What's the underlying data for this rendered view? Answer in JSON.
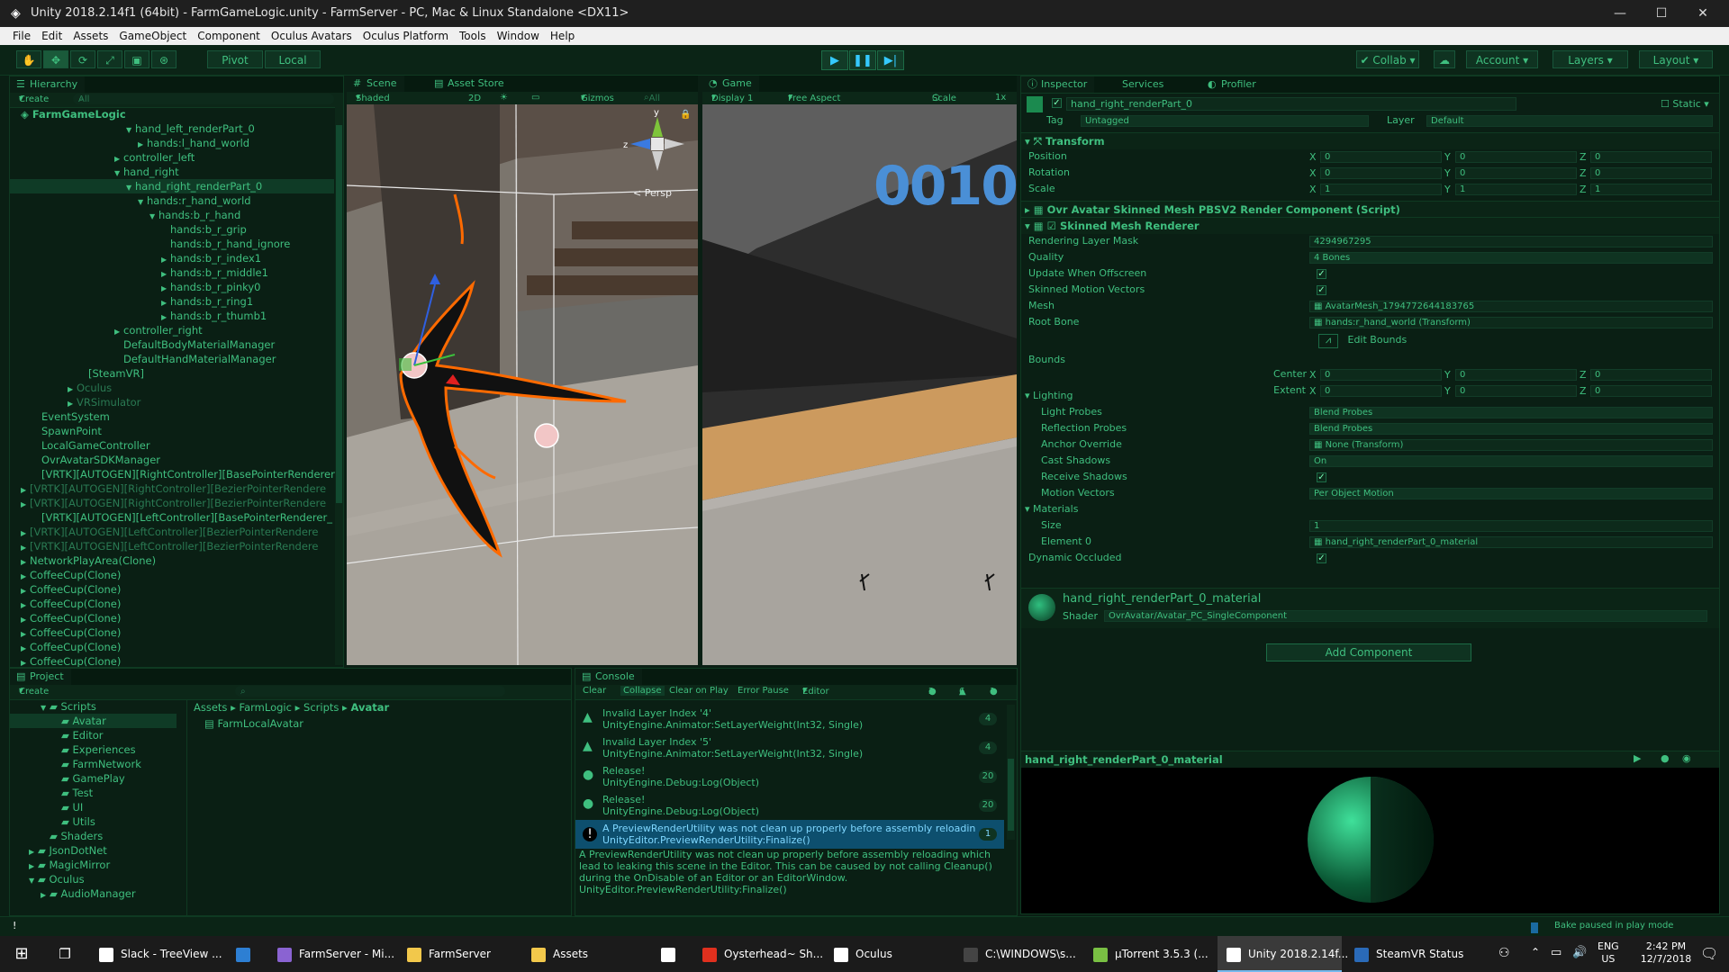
{
  "window": {
    "title": "Unity 2018.2.14f1 (64bit) - FarmGameLogic.unity - FarmServer - PC, Mac & Linux Standalone <DX11>"
  },
  "menu": [
    "File",
    "Edit",
    "Assets",
    "GameObject",
    "Component",
    "Oculus Avatars",
    "Oculus Platform",
    "Tools",
    "Window",
    "Help"
  ],
  "toolbar": {
    "pivot": "Pivot",
    "local": "Local",
    "collab": "Collab",
    "account": "Account",
    "layers": "Layers",
    "layout": "Layout"
  },
  "hierarchy": {
    "tab": "Hierarchy",
    "create": "Create",
    "search": "All",
    "scene": "FarmGameLogic",
    "items": [
      {
        "label": "hand_left_renderPart_0",
        "indent": 9,
        "arrow": "open"
      },
      {
        "label": "hands:l_hand_world",
        "indent": 10,
        "arrow": "closed"
      },
      {
        "label": "controller_left",
        "indent": 8,
        "arrow": "closed"
      },
      {
        "label": "hand_right",
        "indent": 8,
        "arrow": "open"
      },
      {
        "label": "hand_right_renderPart_0",
        "indent": 9,
        "arrow": "open",
        "sel": true
      },
      {
        "label": "hands:r_hand_world",
        "indent": 10,
        "arrow": "open"
      },
      {
        "label": "hands:b_r_hand",
        "indent": 11,
        "arrow": "open"
      },
      {
        "label": "hands:b_r_grip",
        "indent": 12,
        "arrow": ""
      },
      {
        "label": "hands:b_r_hand_ignore",
        "indent": 12,
        "arrow": ""
      },
      {
        "label": "hands:b_r_index1",
        "indent": 12,
        "arrow": "closed"
      },
      {
        "label": "hands:b_r_middle1",
        "indent": 12,
        "arrow": "closed"
      },
      {
        "label": "hands:b_r_pinky0",
        "indent": 12,
        "arrow": "closed"
      },
      {
        "label": "hands:b_r_ring1",
        "indent": 12,
        "arrow": "closed"
      },
      {
        "label": "hands:b_r_thumb1",
        "indent": 12,
        "arrow": "closed"
      },
      {
        "label": "controller_right",
        "indent": 8,
        "arrow": "closed"
      },
      {
        "label": "DefaultBodyMaterialManager",
        "indent": 8,
        "arrow": ""
      },
      {
        "label": "DefaultHandMaterialManager",
        "indent": 8,
        "arrow": ""
      },
      {
        "label": "[SteamVR]",
        "indent": 5,
        "arrow": ""
      },
      {
        "label": "Oculus",
        "indent": 4,
        "arrow": "closed",
        "dim": true
      },
      {
        "label": "VRSimulator",
        "indent": 4,
        "arrow": "closed",
        "dim": true
      },
      {
        "label": "EventSystem",
        "indent": 1,
        "arrow": ""
      },
      {
        "label": "SpawnPoint",
        "indent": 1,
        "arrow": ""
      },
      {
        "label": "LocalGameController",
        "indent": 1,
        "arrow": ""
      },
      {
        "label": "OvrAvatarSDKManager",
        "indent": 1,
        "arrow": ""
      },
      {
        "label": "[VRTK][AUTOGEN][RightController][BasePointerRenderer",
        "indent": 1,
        "arrow": ""
      },
      {
        "label": "[VRTK][AUTOGEN][RightController][BezierPointerRendere",
        "indent": 0,
        "arrow": "closed",
        "dim": true
      },
      {
        "label": "[VRTK][AUTOGEN][RightController][BezierPointerRendere",
        "indent": 0,
        "arrow": "closed",
        "dim": true
      },
      {
        "label": "[VRTK][AUTOGEN][LeftController][BasePointerRenderer_",
        "indent": 1,
        "arrow": ""
      },
      {
        "label": "[VRTK][AUTOGEN][LeftController][BezierPointerRendere",
        "indent": 0,
        "arrow": "closed",
        "dim": true
      },
      {
        "label": "[VRTK][AUTOGEN][LeftController][BezierPointerRendere",
        "indent": 0,
        "arrow": "closed",
        "dim": true
      },
      {
        "label": "NetworkPlayArea(Clone)",
        "indent": 0,
        "arrow": "closed"
      },
      {
        "label": "CoffeeCup(Clone)",
        "indent": 0,
        "arrow": "closed"
      },
      {
        "label": "CoffeeCup(Clone)",
        "indent": 0,
        "arrow": "closed"
      },
      {
        "label": "CoffeeCup(Clone)",
        "indent": 0,
        "arrow": "closed"
      },
      {
        "label": "CoffeeCup(Clone)",
        "indent": 0,
        "arrow": "closed"
      },
      {
        "label": "CoffeeCup(Clone)",
        "indent": 0,
        "arrow": "closed"
      },
      {
        "label": "CoffeeCup(Clone)",
        "indent": 0,
        "arrow": "closed"
      },
      {
        "label": "CoffeeCup(Clone)",
        "indent": 0,
        "arrow": "closed"
      }
    ]
  },
  "scene": {
    "tab": "Scene",
    "assetstore": "Asset Store",
    "shaded": "Shaded",
    "twod": "2D",
    "gizmos": "Gizmos",
    "all": "All",
    "persp": "Persp",
    "axis_y": "y",
    "axis_z": "z"
  },
  "game": {
    "tab": "Game",
    "display": "Display 1",
    "aspect": "Free Aspect",
    "scale": "Scale",
    "scale_val": "1x",
    "sign": "0010"
  },
  "inspector": {
    "tab": "Inspector",
    "services": "Services",
    "profiler": "Profiler",
    "object_name": "hand_right_renderPart_0",
    "static": "Static",
    "tag_label": "Tag",
    "tag": "Untagged",
    "layer_label": "Layer",
    "layer": "Default",
    "transform": {
      "title": "Transform",
      "rows": [
        {
          "label": "Position",
          "x": "0",
          "y": "0",
          "z": "0"
        },
        {
          "label": "Rotation",
          "x": "0",
          "y": "0",
          "z": "0"
        },
        {
          "label": "Scale",
          "x": "1",
          "y": "1",
          "z": "1"
        }
      ]
    },
    "ovr_component": "Ovr Avatar Skinned Mesh PBSV2 Render Component (Script)",
    "smr": {
      "title": "Skinned Mesh Renderer",
      "rendering_layer_mask_label": "Rendering Layer Mask",
      "rendering_layer_mask": "4294967295",
      "quality_label": "Quality",
      "quality": "4 Bones",
      "update_offscreen_label": "Update When Offscreen",
      "skinned_motion_label": "Skinned Motion Vectors",
      "mesh_label": "Mesh",
      "mesh": "AvatarMesh_1794772644183765",
      "root_bone_label": "Root Bone",
      "root_bone": "hands:r_hand_world (Transform)",
      "edit_bounds": "Edit Bounds",
      "bounds_label": "Bounds",
      "center_label": "Center",
      "extent_label": "Extent",
      "center": {
        "x": "0",
        "y": "0",
        "z": "0"
      },
      "extent": {
        "x": "0",
        "y": "0",
        "z": "0"
      },
      "lighting_label": "Lighting",
      "light_probes_label": "Light Probes",
      "light_probes": "Blend Probes",
      "reflection_probes_label": "Reflection Probes",
      "reflection_probes": "Blend Probes",
      "anchor_override_label": "Anchor Override",
      "anchor_override": "None (Transform)",
      "cast_shadows_label": "Cast Shadows",
      "cast_shadows": "On",
      "receive_shadows_label": "Receive Shadows",
      "motion_vectors_label": "Motion Vectors",
      "motion_vectors": "Per Object Motion",
      "materials_label": "Materials",
      "size_label": "Size",
      "size": "1",
      "element0_label": "Element 0",
      "element0": "hand_right_renderPart_0_material",
      "dynamic_occluded_label": "Dynamic Occluded"
    },
    "material": {
      "name": "hand_right_renderPart_0_material",
      "shader_label": "Shader",
      "shader": "OvrAvatar/Avatar_PC_SingleComponent"
    },
    "add_component": "Add Component",
    "preview_title": "hand_right_renderPart_0_material"
  },
  "project": {
    "tab": "Project",
    "create": "Create",
    "breadcrumb": [
      "Assets",
      "FarmLogic",
      "Scripts",
      "Avatar"
    ],
    "asset": "FarmLocalAvatar",
    "tree": [
      {
        "label": "Scripts",
        "indent": 2,
        "arrow": "open"
      },
      {
        "label": "Avatar",
        "indent": 3,
        "arrow": "",
        "sel": true
      },
      {
        "label": "Editor",
        "indent": 3,
        "arrow": ""
      },
      {
        "label": "Experiences",
        "indent": 3,
        "arrow": ""
      },
      {
        "label": "FarmNetwork",
        "indent": 3,
        "arrow": ""
      },
      {
        "label": "GamePlay",
        "indent": 3,
        "arrow": ""
      },
      {
        "label": "Test",
        "indent": 3,
        "arrow": ""
      },
      {
        "label": "UI",
        "indent": 3,
        "arrow": ""
      },
      {
        "label": "Utils",
        "indent": 3,
        "arrow": ""
      },
      {
        "label": "Shaders",
        "indent": 2,
        "arrow": ""
      },
      {
        "label": "JsonDotNet",
        "indent": 1,
        "arrow": "closed"
      },
      {
        "label": "MagicMirror",
        "indent": 1,
        "arrow": "closed"
      },
      {
        "label": "Oculus",
        "indent": 1,
        "arrow": "open"
      },
      {
        "label": "AudioManager",
        "indent": 2,
        "arrow": "closed"
      }
    ]
  },
  "console": {
    "tab": "Console",
    "clear": "Clear",
    "collapse": "Collapse",
    "clear_on_play": "Clear on Play",
    "error_pause": "Error Pause",
    "editor": "Editor",
    "count_info": "2",
    "count_warn": "6",
    "count_err": "1",
    "logs": [
      {
        "type": "warn",
        "l1": "Invalid Layer Index '4'",
        "l2": "UnityEngine.Animator:SetLayerWeight(Int32, Single)",
        "count": "4"
      },
      {
        "type": "warn",
        "l1": "Invalid Layer Index '5'",
        "l2": "UnityEngine.Animator:SetLayerWeight(Int32, Single)",
        "count": "4"
      },
      {
        "type": "info",
        "l1": "Release!",
        "l2": "UnityEngine.Debug:Log(Object)",
        "count": "20"
      },
      {
        "type": "info",
        "l1": "Release!",
        "l2": "UnityEngine.Debug:Log(Object)",
        "count": "20"
      },
      {
        "type": "error",
        "l1": "A PreviewRenderUtility was not clean up properly before assembly reloadin",
        "l2": "UnityEditor.PreviewRenderUtility:Finalize()",
        "count": "1"
      }
    ],
    "detail": [
      "A PreviewRenderUtility was not clean up properly before assembly reloading which",
      "lead to leaking this scene in the Editor. This can be caused by not calling Cleanup()",
      "during the OnDisable of an Editor or an EditorWindow.",
      "UnityEditor.PreviewRenderUtility:Finalize()"
    ]
  },
  "status": {
    "bake": "Bake paused in play mode"
  },
  "taskbar": {
    "tasks": [
      {
        "label": "Slack - TreeView ...",
        "color": "#ffffff"
      },
      {
        "label": "",
        "color": "#2d7fd3"
      },
      {
        "label": "FarmServer - Mi...",
        "color": "#8a63d2"
      },
      {
        "label": "FarmServer",
        "color": "#f2c84b"
      },
      {
        "label": "Assets",
        "color": "#f2c84b"
      },
      {
        "label": "",
        "color": "#ffffff"
      },
      {
        "label": "Oysterhead~ Sh...",
        "color": "#e0301e"
      },
      {
        "label": "Oculus",
        "color": "#ffffff"
      },
      {
        "label": "C:\\WINDOWS\\s...",
        "color": "#444444"
      },
      {
        "label": "µTorrent 3.5.3 (...",
        "color": "#79c043"
      },
      {
        "label": "Unity 2018.2.14f...",
        "color": "#ffffff"
      },
      {
        "label": "SteamVR Status",
        "color": "#2a6ab8"
      }
    ],
    "lang1": "ENG",
    "lang2": "US",
    "time": "2:42 PM",
    "date": "12/7/2018"
  }
}
